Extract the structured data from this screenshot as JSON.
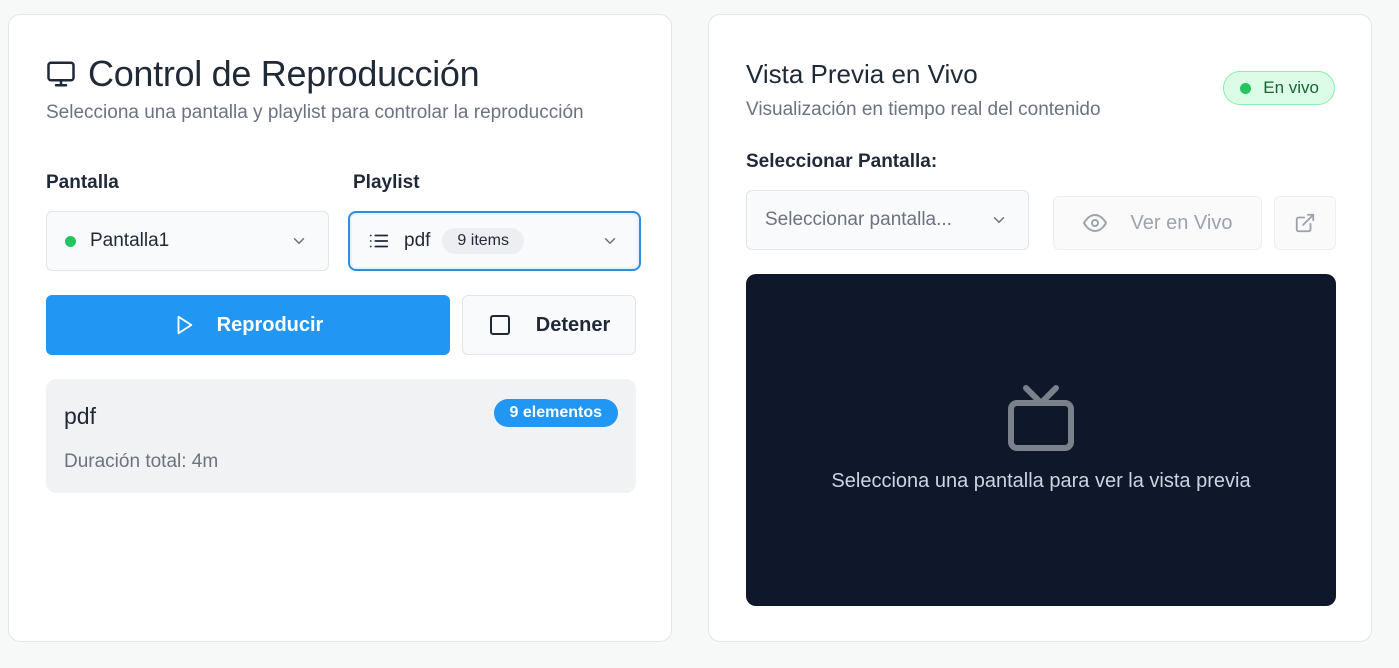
{
  "playback": {
    "title": "Control de Reproducción",
    "subtitle": "Selecciona una pantalla y playlist para controlar la reproducción",
    "screen_label": "Pantalla",
    "playlist_label": "Playlist",
    "screen_value": "Pantalla1",
    "screen_status_color": "#22c55e",
    "playlist_value": "pdf",
    "playlist_items_badge": "9 items",
    "play_button": "Reproducir",
    "stop_button": "Detener",
    "info": {
      "name": "pdf",
      "count_badge": "9 elementos",
      "duration": "Duración total: 4m"
    }
  },
  "preview": {
    "title": "Vista Previa en Vivo",
    "subtitle": "Visualización en tiempo real del contenido",
    "live_badge": "En vivo",
    "select_label": "Seleccionar Pantalla:",
    "select_placeholder": "Seleccionar pantalla...",
    "live_button": "Ver en Vivo",
    "empty_message": "Selecciona una pantalla para ver la vista previa"
  },
  "colors": {
    "accent": "#2196f3",
    "live_green": "#22c55e",
    "preview_bg": "#0f172a"
  }
}
